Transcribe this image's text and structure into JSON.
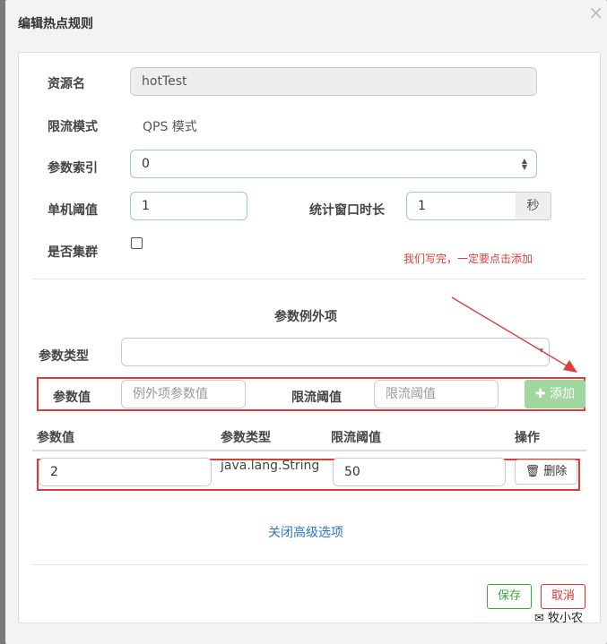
{
  "dialog": {
    "title": "编辑热点规则",
    "close_icon": "×"
  },
  "form": {
    "resource_label": "资源名",
    "resource_value": "hotTest",
    "mode_label": "限流模式",
    "mode_value": "QPS 模式",
    "param_index_label": "参数索引",
    "param_index_value": "0",
    "threshold_label": "单机阈值",
    "threshold_value": "1",
    "window_label": "统计窗口时长",
    "window_value": "1",
    "window_unit": "秒",
    "cluster_label": "是否集群",
    "cluster_checked": false
  },
  "annotation": {
    "note": "我们写完，一定要点击添加",
    "color": "#e23b3b"
  },
  "exceptions": {
    "section_title": "参数例外项",
    "param_type_label": "参数类型",
    "param_type_value": "",
    "param_value_label": "参数值",
    "param_value_placeholder": "例外项参数值",
    "limit_label": "限流阈值",
    "limit_placeholder": "限流阈值",
    "add_button": "添加",
    "add_icon": "✚"
  },
  "table": {
    "headers": [
      "参数值",
      "参数类型",
      "限流阈值",
      "操作"
    ],
    "rows": [
      {
        "param": "2",
        "type": "java.lang.String",
        "limit": "50",
        "action": "删除"
      }
    ]
  },
  "links": {
    "close_advanced": "关闭高级选项"
  },
  "footer": {
    "save": "保存",
    "cancel": "取消"
  },
  "watermark": {
    "text": "牧小农"
  }
}
